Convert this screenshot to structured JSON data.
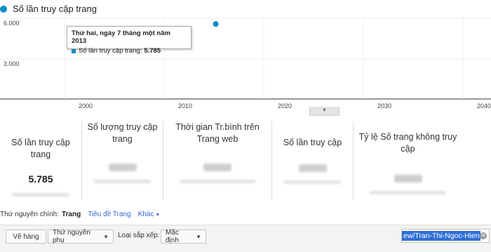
{
  "chart": {
    "legend_label": "Số lần truy cập trang",
    "series_color": "#058dc7",
    "y_ticks": [
      "6.000",
      "3.000"
    ],
    "x_ticks": [
      "2000",
      "2010",
      "2020",
      "2030",
      "2040"
    ],
    "tooltip": {
      "date": "Thứ hai, ngày 7 tháng một năm 2013",
      "series": "Số lần truy cập trang:",
      "value": "5.785"
    }
  },
  "chart_data": {
    "type": "scatter",
    "title": "",
    "series": [
      {
        "name": "Số lần truy cập trang",
        "points": [
          {
            "x": 2013,
            "y": 5785
          }
        ]
      }
    ],
    "xlim": [
      1990,
      2040
    ],
    "ylim": [
      0,
      6000
    ],
    "grid": true,
    "legend": "top-left"
  },
  "cards": [
    {
      "label": "Số lần truy cập trang",
      "value": "5.785"
    },
    {
      "label": "Số lượng truy cập trang",
      "value": ""
    },
    {
      "label": "Thời gian Tr.bình trên Trang web",
      "value": ""
    },
    {
      "label": "Số lần truy cập",
      "value": ""
    },
    {
      "label": "Tỷ lệ Số trang không truy cập",
      "value": ""
    }
  ],
  "dimension": {
    "label": "Thứ nguyên chính:",
    "active": "Trang",
    "option1": "Tiêu đề Trang",
    "more": "Khác"
  },
  "toolbar": {
    "plot_rows": "Vẽ hàng",
    "secondary_dimension": "Thứ nguyên phụ",
    "sort_label": "Loại sắp xếp:",
    "sort_value": "Mặc định",
    "search_value": "ew/Tran-Thi-Ngoc-Hien"
  }
}
